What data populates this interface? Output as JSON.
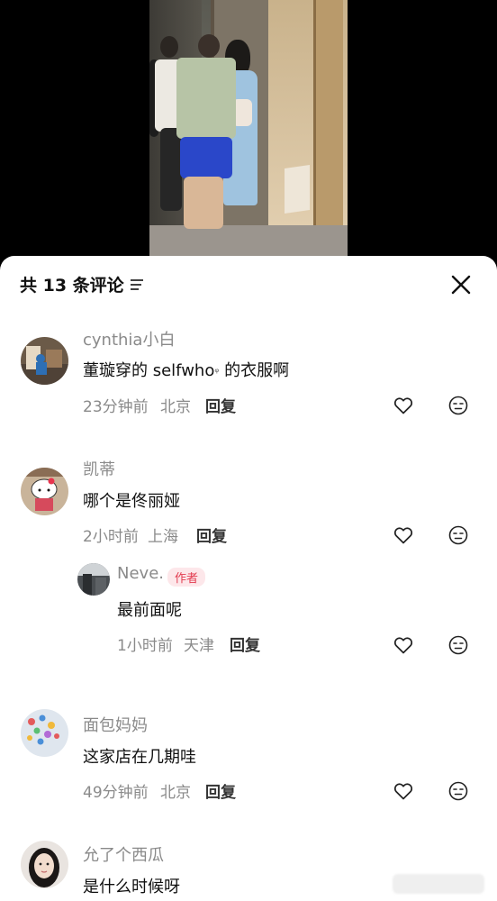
{
  "header": {
    "title": "共 13 条评论",
    "sort_icon": "sort-lines-icon",
    "close_icon": "close-x-icon"
  },
  "comments": [
    {
      "user": "cynthia小白",
      "text_before": "董璇穿的 selfwho",
      "search_mark": "ᵠ",
      "text_after": " 的衣服啊",
      "time": "23分钟前",
      "location": "北京",
      "reply": "回复"
    },
    {
      "user": "凯蒂",
      "text": "哪个是佟丽娅",
      "time": "2小时前",
      "location": "上海",
      "reply": "回复",
      "replies": [
        {
          "user": "Neve.",
          "badge": "作者",
          "text": "最前面呢",
          "time": "1小时前",
          "location": "天津",
          "reply": "回复"
        }
      ]
    },
    {
      "user": "面包妈妈",
      "text": "这家店在几期哇",
      "time": "49分钟前",
      "location": "北京",
      "reply": "回复"
    },
    {
      "user": "允了个西瓜",
      "text": "是什么时候呀"
    }
  ],
  "colors": {
    "meta_gray": "#8a8a8a",
    "author_red": "#e23b4f",
    "author_bg": "#fde7ea"
  }
}
